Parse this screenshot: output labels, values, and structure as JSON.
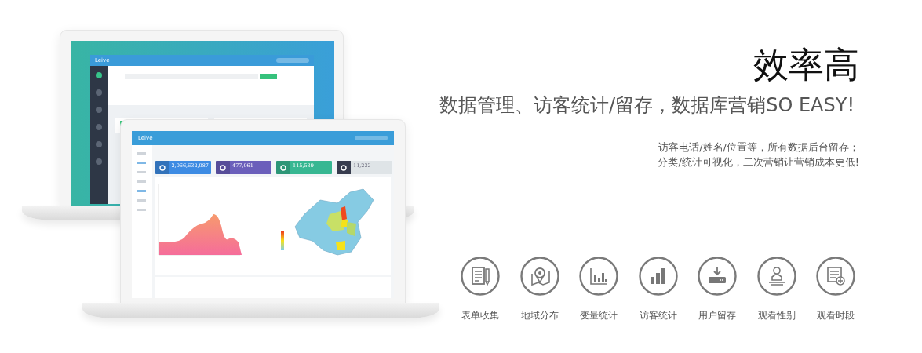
{
  "headline": "效率高",
  "subtitle": "数据管理、访客统计/留存，数据库营销SO EASY!",
  "description": [
    "访客电话/姓名/位置等，所有数据后台留存；",
    "分类/统计可视化，二次营销让营销成本更低!"
  ],
  "laptops": {
    "back": {
      "logo": "Leive"
    },
    "front": {
      "logo": "Leive",
      "stats": [
        {
          "value": "2,066,632,087",
          "kind": "solid",
          "color": "#3d8be3"
        },
        {
          "value": "477,061",
          "kind": "solid",
          "color": "#6b5fbb"
        },
        {
          "value": "115,539",
          "kind": "solid",
          "color": "#37b792"
        },
        {
          "value": "11,232",
          "kind": "light",
          "color": "#373c4e"
        }
      ]
    }
  },
  "features": [
    {
      "label": "表单收集",
      "kind": "form"
    },
    {
      "label": "地域分布",
      "kind": "map"
    },
    {
      "label": "变量统计",
      "kind": "bars"
    },
    {
      "label": "访客统计",
      "kind": "signal"
    },
    {
      "label": "用户留存",
      "kind": "download"
    },
    {
      "label": "观看性别",
      "kind": "person"
    },
    {
      "label": "观看时段",
      "kind": "list-add"
    }
  ]
}
